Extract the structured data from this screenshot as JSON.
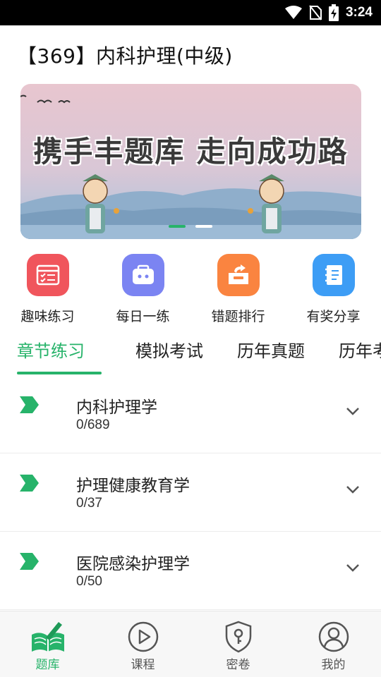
{
  "status_bar": {
    "time": "3:24"
  },
  "page": {
    "title": "【369】内科护理(中级)"
  },
  "banner": {
    "slogan": "携手丰题库 走向成功路",
    "active_slide": 1,
    "slides": 2
  },
  "quick_actions": [
    {
      "label": "趣味练习",
      "icon": "quiz-checklist-icon",
      "color": "#f0555c"
    },
    {
      "label": "每日一练",
      "icon": "daily-practice-icon",
      "color": "#7b84f2"
    },
    {
      "label": "错题排行",
      "icon": "wrong-ranking-icon",
      "color": "#fa8440"
    },
    {
      "label": "有奖分享",
      "icon": "share-book-icon",
      "color": "#3d9df5"
    }
  ],
  "tabs": [
    {
      "label": "章节练习",
      "active": true
    },
    {
      "label": "模拟考试",
      "active": false
    },
    {
      "label": "历年真题",
      "active": false
    },
    {
      "label": "历年考",
      "active": false
    }
  ],
  "chapters": [
    {
      "title": "内科护理学",
      "progress": "0/689"
    },
    {
      "title": "护理健康教育学",
      "progress": "0/37"
    },
    {
      "title": "医院感染护理学",
      "progress": "0/50"
    }
  ],
  "bottom_nav": [
    {
      "label": "题库",
      "icon": "question-bank-icon",
      "active": true
    },
    {
      "label": "课程",
      "icon": "play-course-icon",
      "active": false
    },
    {
      "label": "密卷",
      "icon": "secret-paper-shield-icon",
      "active": false
    },
    {
      "label": "我的",
      "icon": "profile-icon",
      "active": false
    }
  ],
  "colors": {
    "accent": "#27b36a",
    "chevron": "#555555"
  }
}
